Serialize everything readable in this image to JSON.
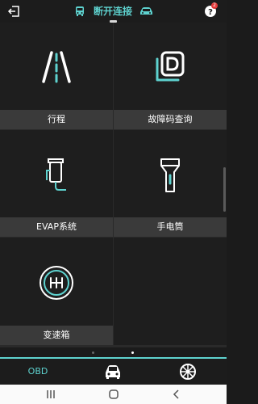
{
  "header": {
    "back_icon": "exit-icon",
    "status_text": "断开连接",
    "help_badge": "2"
  },
  "tiles": [
    {
      "label": "行程",
      "icon": "road-icon"
    },
    {
      "label": "故障码查询",
      "icon": "fault-code-icon"
    },
    {
      "label": "EVAP系统",
      "icon": "evap-canister-icon"
    },
    {
      "label": "手电筒",
      "icon": "flashlight-icon"
    },
    {
      "label": "变速箱",
      "icon": "gearbox-icon"
    }
  ],
  "pager": {
    "pages": 2,
    "active_page": 2
  },
  "bottom_tabs": [
    {
      "label": "OBD",
      "active": true
    },
    {
      "label": "",
      "icon": "car-icon"
    },
    {
      "label": "",
      "icon": "wheel-icon"
    }
  ],
  "colors": {
    "accent": "#5ed2cf",
    "tile_bg": "#1e1e1e",
    "label_bg": "#3a3a3a"
  }
}
